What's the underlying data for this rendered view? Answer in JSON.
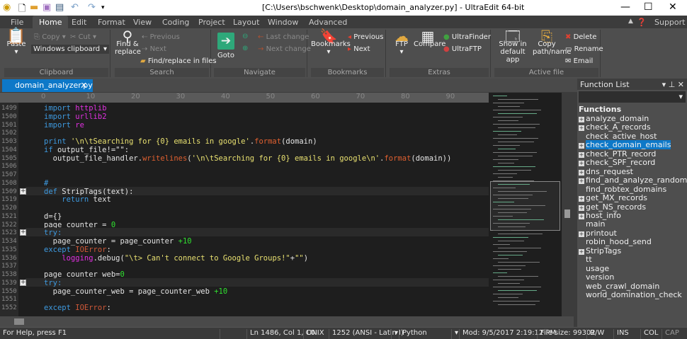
{
  "title": "[C:\\Users\\bschwenk\\Desktop\\domain_analyzer.py] - UltraEdit 64-bit",
  "ribbon_tabs": [
    "File",
    "Home",
    "Edit",
    "Format",
    "View",
    "Coding",
    "Project",
    "Layout",
    "Window",
    "Advanced"
  ],
  "support": "Support",
  "clipboard": {
    "paste": "Paste",
    "copy": "Copy",
    "cut": "Cut",
    "clipboard_select": "Windows clipboard",
    "label": "Clipboard"
  },
  "search": {
    "find_replace": "Find & replace",
    "previous": "Previous",
    "next": "Next",
    "find_in_files": "Find/replace in files",
    "label": "Search"
  },
  "navigate": {
    "goto": "Goto",
    "last_change": "Last change",
    "next_change": "Next change",
    "label": "Navigate"
  },
  "bookmarks": {
    "bookmarks": "Bookmarks",
    "previous": "Previous",
    "next": "Next",
    "label": "Bookmarks"
  },
  "extras": {
    "ftp": "FTP",
    "compare": "Compare",
    "ultrafinder": "UltraFinder",
    "ultraftp": "UltraFTP",
    "label": "Extras"
  },
  "active_file": {
    "show_default": "Show in default app",
    "copy_path": "Copy path/name",
    "delete": "Delete",
    "rename": "Rename",
    "email": "Email",
    "label": "Active file"
  },
  "doc_tab": "domain_analyzer.py",
  "ruler": [
    "0",
    "10",
    "20",
    "30",
    "40",
    "50",
    "60",
    "70",
    "80",
    "90"
  ],
  "code_lines": [
    {
      "n": "1499",
      "t": [
        [
          "import ",
          "k"
        ],
        [
          "httplib",
          "m"
        ]
      ]
    },
    {
      "n": "1500",
      "t": [
        [
          "import ",
          "k"
        ],
        [
          "urllib2",
          "m"
        ]
      ]
    },
    {
      "n": "1501",
      "t": [
        [
          "import ",
          "k"
        ],
        [
          "re",
          "m"
        ]
      ]
    },
    {
      "n": "1502",
      "t": []
    },
    {
      "n": "1503",
      "t": [
        [
          "print ",
          "k"
        ],
        [
          "'\\n\\tSearching for {0} emails in google'",
          "s"
        ],
        [
          ".",
          ""
        ],
        [
          "format",
          "f"
        ],
        [
          "(domain)",
          ""
        ]
      ]
    },
    {
      "n": "1504",
      "t": [
        [
          "if ",
          "k"
        ],
        [
          "output_file!=\"\":",
          ""
        ]
      ]
    },
    {
      "n": "1505",
      "t": [
        [
          "  output_file_handler.",
          ""
        ],
        [
          "writelines",
          "f"
        ],
        [
          "(",
          ""
        ],
        [
          "'\\n\\tSearching for {0} emails in google\\n'",
          "s"
        ],
        [
          ".",
          ""
        ],
        [
          "format",
          "f"
        ],
        [
          "(domain))",
          ""
        ]
      ]
    },
    {
      "n": "1506",
      "t": []
    },
    {
      "n": "1507",
      "t": []
    },
    {
      "n": "1508",
      "t": [
        [
          "#",
          "k"
        ]
      ]
    },
    {
      "n": "1509",
      "t": [
        [
          "def ",
          "k"
        ],
        [
          "StripTags(text):",
          ""
        ]
      ],
      "fold": true
    },
    {
      "n": "1519",
      "t": [
        [
          "    return ",
          "k"
        ],
        [
          "text",
          ""
        ]
      ]
    },
    {
      "n": "1520",
      "t": []
    },
    {
      "n": "1521",
      "t": [
        [
          "d={}",
          ""
        ]
      ]
    },
    {
      "n": "1522",
      "t": [
        [
          "page_counter = ",
          ""
        ],
        [
          "0",
          "n"
        ]
      ]
    },
    {
      "n": "1523",
      "t": [
        [
          "try:",
          "k"
        ]
      ],
      "fold": true
    },
    {
      "n": "1534",
      "t": [
        [
          "  page_counter = page_counter ",
          ""
        ],
        [
          "+10",
          "n"
        ]
      ]
    },
    {
      "n": "1535",
      "t": [
        [
          "except ",
          "k"
        ],
        [
          "IOError",
          "e"
        ],
        [
          ":",
          ""
        ]
      ]
    },
    {
      "n": "1536",
      "t": [
        [
          "    ",
          ""
        ],
        [
          "logging",
          "m"
        ],
        [
          ".debug(",
          ""
        ],
        [
          "\"\\t> Can't connect to Google Groups!\"",
          "s"
        ],
        [
          "+",
          ""
        ],
        [
          "\"\"",
          "s"
        ],
        [
          ")",
          ""
        ]
      ]
    },
    {
      "n": "1537",
      "t": []
    },
    {
      "n": "1538",
      "t": [
        [
          "page_counter_web=",
          ""
        ],
        [
          "0",
          "n"
        ]
      ]
    },
    {
      "n": "1539",
      "t": [
        [
          "try:",
          "k"
        ]
      ],
      "fold": true
    },
    {
      "n": "1550",
      "t": [
        [
          "  page_counter_web = page_counter_web ",
          ""
        ],
        [
          "+10",
          "n"
        ]
      ]
    },
    {
      "n": "1551",
      "t": []
    },
    {
      "n": "1552",
      "t": [
        [
          "except ",
          "k"
        ],
        [
          "IOError",
          "e"
        ],
        [
          ":",
          ""
        ]
      ]
    }
  ],
  "function_list": {
    "title": "Function List",
    "root": "Functions",
    "selected": "check_domain_emails",
    "items": [
      {
        "name": "analyze_domain",
        "expandable": true
      },
      {
        "name": "check_A_records",
        "expandable": true
      },
      {
        "name": "check_active_host",
        "expandable": false
      },
      {
        "name": "check_domain_emails",
        "expandable": true
      },
      {
        "name": "check_PTR_record",
        "expandable": true
      },
      {
        "name": "check_SPF_record",
        "expandable": true
      },
      {
        "name": "dns_request",
        "expandable": true
      },
      {
        "name": "find_and_analyze_random_domain",
        "expandable": true
      },
      {
        "name": "find_robtex_domains",
        "expandable": false
      },
      {
        "name": "get_MX_records",
        "expandable": true
      },
      {
        "name": "get_NS_records",
        "expandable": true
      },
      {
        "name": "host_info",
        "expandable": true
      },
      {
        "name": "main",
        "expandable": false
      },
      {
        "name": "printout",
        "expandable": true
      },
      {
        "name": "robin_hood_send",
        "expandable": false
      },
      {
        "name": "StripTags",
        "expandable": true
      },
      {
        "name": "tt",
        "expandable": false
      },
      {
        "name": "usage",
        "expandable": false
      },
      {
        "name": "version",
        "expandable": false
      },
      {
        "name": "web_crawl_domain",
        "expandable": false
      },
      {
        "name": "world_domination_check",
        "expandable": false
      }
    ]
  },
  "status": {
    "help": "For Help, press F1",
    "position": "Ln 1486, Col 1, C0",
    "line_ending": "UNIX",
    "encoding": "1252  (ANSI - Latin I)",
    "language": "Python",
    "modified": "Mod: 9/5/2017 2:19:12 PM",
    "file_size": "File size: 99302",
    "rw": "R/W",
    "ins": "INS",
    "col": "COL",
    "cap": "CAP"
  },
  "colors": {
    "accent": "#0d78c8",
    "keyword": "#3e9ae0",
    "module": "#e030e0",
    "string": "#e8e070",
    "function": "#e06030",
    "number": "#30e030"
  }
}
